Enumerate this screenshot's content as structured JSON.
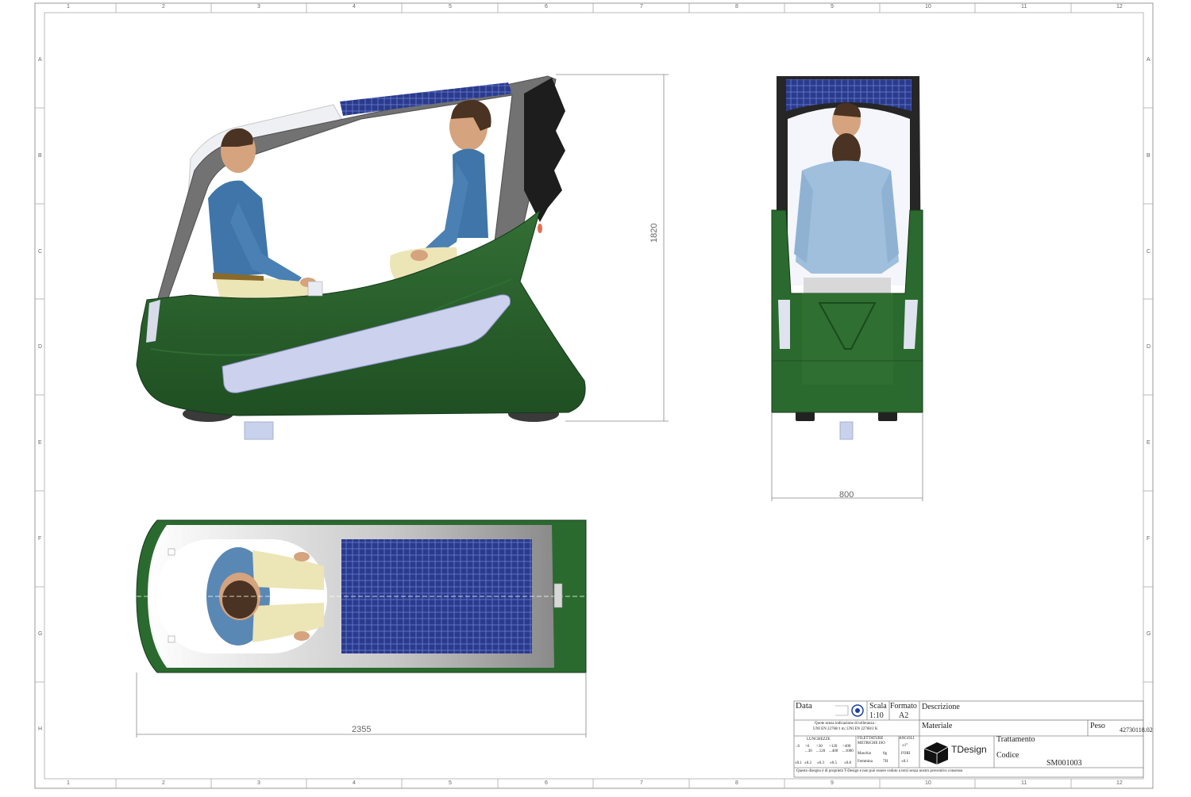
{
  "sheet": {
    "zones_horizontal": [
      "1",
      "2",
      "3",
      "4",
      "5",
      "6",
      "7",
      "8",
      "9",
      "10",
      "11",
      "12"
    ],
    "zones_vertical": [
      "A",
      "B",
      "C",
      "D",
      "E",
      "F",
      "G",
      "H"
    ]
  },
  "dimensions": {
    "height": "1820",
    "width": "800",
    "length": "2355"
  },
  "title_block": {
    "data_label": "Data",
    "scala_label": "Scala",
    "scala_value": "1:10",
    "formato_label": "Formato",
    "formato_value": "A2",
    "descrizione_label": "Descrizione",
    "materiale_label": "Materiale",
    "peso_label": "Peso",
    "peso_value": "42730118.02",
    "trattamento_label": "Trattamento",
    "codice_label": "Codice",
    "codice_value": "SM001003",
    "tolerance_note_1": "Quote senza indicazione di tolleranza :",
    "tolerance_note_2": "UNI EN 22768/1 m; UNI EN 22768/2 K",
    "lunghezze_label": "LUNGHEZZE",
    "filettature_label": "FILETTATURE METRICHE ISO",
    "angoli_label": "ANGOLI",
    "len_ranges": [
      "..6",
      ">6 ...30",
      ">30 ...120",
      ">120 ...400",
      ">400 ...1000"
    ],
    "len_tols": [
      "±0.1",
      "±0.2",
      "±0.3",
      "±0.5",
      "±0.8"
    ],
    "maschio_label": "Maschio",
    "maschio_value": "6g",
    "femmina_label": "Femmina",
    "femmina_value": "7H",
    "angoli_value": "±1°",
    "fori_label": "FORI",
    "fori_value": "±0.1",
    "brand": "TDesign",
    "property_note": "Questo disegno è di proprietà T-Design e non può essere ceduto a terzi senza nostro preventivo consenso"
  },
  "colors": {
    "body_green": "#2b6a2e",
    "body_green_dark": "#1c4a1f",
    "frame_gray": "#6e6e6e",
    "solar_blue": "#23317a",
    "window_lilac": "#c9cdea",
    "shirt_blue": "#4a7fb0",
    "pants_khaki": "#e9e2b0",
    "skin": "#d9a47c",
    "hair": "#4a3322"
  }
}
